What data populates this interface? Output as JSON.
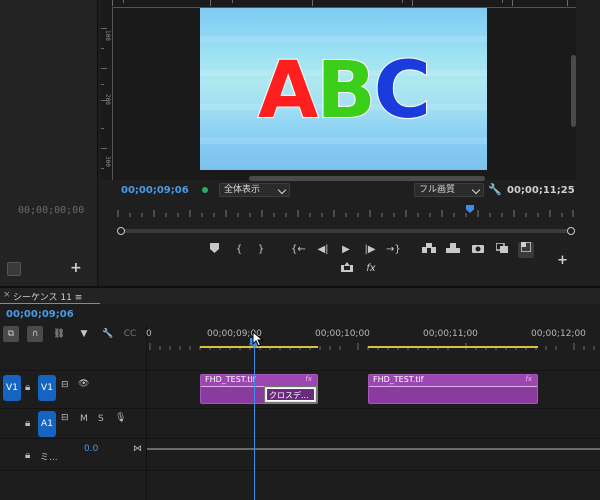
{
  "left_panel": {
    "timecode": "00;00;00;00"
  },
  "monitor": {
    "video_text": {
      "a": "A",
      "b": "B",
      "c": "C",
      "a_color": "#ff1f1f",
      "b_color": "#3ccf1a",
      "c_color": "#1a3cdc"
    },
    "ruler_labels": [
      "100",
      "200",
      "300"
    ],
    "current_timecode": "00;00;09;06",
    "zoom_select": "全体表示",
    "quality_select": "フル画質",
    "duration_timecode": "00;00;11;25",
    "accent_color": "#4a9be6"
  },
  "transport": {
    "marker": "marker-icon",
    "in": "{",
    "out": "}",
    "goto_in": "{←",
    "step_back": "◀|",
    "play": "▶",
    "step_fwd": "|▶",
    "goto_out": "→}",
    "insert": "insert-icon",
    "overwrite": "overwrite-icon",
    "export_frame": "camera-icon",
    "compare": "compare-icon",
    "multi": "multicam-icon",
    "lift": "lift-icon",
    "fx": "fx"
  },
  "timeline": {
    "close": "×",
    "title": "シーケンス 11 ≡",
    "timecode": "00;00;09;06",
    "ruler": [
      "0",
      "00;00;09;00",
      "00;00;10;00",
      "00;00;11;00",
      "00;00;12;00"
    ],
    "tracks": {
      "v1_source": "V1",
      "v1_target": "V1",
      "a1_target": "A1",
      "a1_m": "M",
      "a1_s": "S",
      "mix_label": "ミ...",
      "mix_value": "0.0"
    },
    "clips": [
      {
        "name": "FHD_TEST.tif",
        "fx": "fx"
      },
      {
        "name": "FHD_TEST.tif",
        "fx": "fx"
      }
    ],
    "transition": "クロスデ..."
  }
}
